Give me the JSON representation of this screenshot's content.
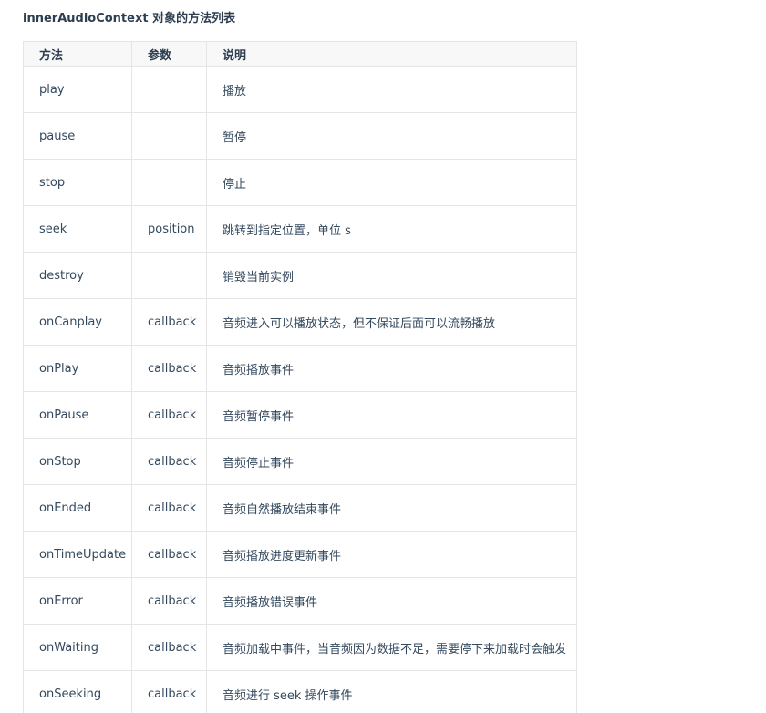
{
  "title": "innerAudioContext 对象的方法列表",
  "table": {
    "headers": [
      "方法",
      "参数",
      "说明"
    ],
    "rows": [
      {
        "method": "play",
        "param": "",
        "desc": "播放"
      },
      {
        "method": "pause",
        "param": "",
        "desc": "暂停"
      },
      {
        "method": "stop",
        "param": "",
        "desc": "停止"
      },
      {
        "method": "seek",
        "param": "position",
        "desc": "跳转到指定位置，单位 s"
      },
      {
        "method": "destroy",
        "param": "",
        "desc": "销毁当前实例"
      },
      {
        "method": "onCanplay",
        "param": "callback",
        "desc": "音频进入可以播放状态，但不保证后面可以流畅播放"
      },
      {
        "method": "onPlay",
        "param": "callback",
        "desc": "音频播放事件"
      },
      {
        "method": "onPause",
        "param": "callback",
        "desc": "音频暂停事件"
      },
      {
        "method": "onStop",
        "param": "callback",
        "desc": "音频停止事件"
      },
      {
        "method": "onEnded",
        "param": "callback",
        "desc": "音频自然播放结束事件"
      },
      {
        "method": "onTimeUpdate",
        "param": "callback",
        "desc": "音频播放进度更新事件"
      },
      {
        "method": "onError",
        "param": "callback",
        "desc": "音频播放错误事件"
      },
      {
        "method": "onWaiting",
        "param": "callback",
        "desc": "音频加载中事件，当音频因为数据不足，需要停下来加载时会触发"
      },
      {
        "method": "onSeeking",
        "param": "callback",
        "desc": "音频进行 seek 操作事件"
      }
    ]
  }
}
